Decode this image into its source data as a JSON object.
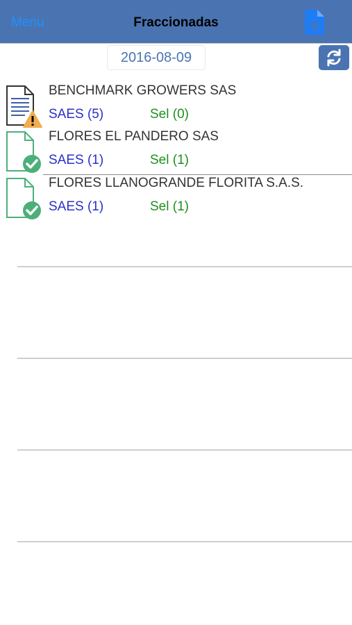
{
  "navbar": {
    "menu_label": "Menu",
    "title": "Fraccionadas",
    "action_icon": "document-add-icon"
  },
  "toolbar": {
    "date": "2016-08-09",
    "refresh_icon": "refresh-icon"
  },
  "colors": {
    "navbar_bg": "#4a74b1",
    "menu_text": "#1e90ff",
    "saes_text": "#2a2fc8",
    "sel_text": "#1e8f1e",
    "warning": "#f0ad4e",
    "success": "#4caf7a"
  },
  "rows": [
    {
      "name": "BENCHMARK GROWERS SAS",
      "saes": "SAES (5)",
      "sel": "Sel (0)",
      "status_icon": "warning-icon"
    },
    {
      "name": "FLORES EL PANDERO SAS",
      "saes": "SAES (1)",
      "sel": "Sel (1)",
      "status_icon": "check-icon"
    },
    {
      "name": "FLORES LLANOGRANDE FLORITA S.A.S.",
      "saes": "SAES (1)",
      "sel": "Sel (1)",
      "status_icon": "check-icon"
    }
  ]
}
